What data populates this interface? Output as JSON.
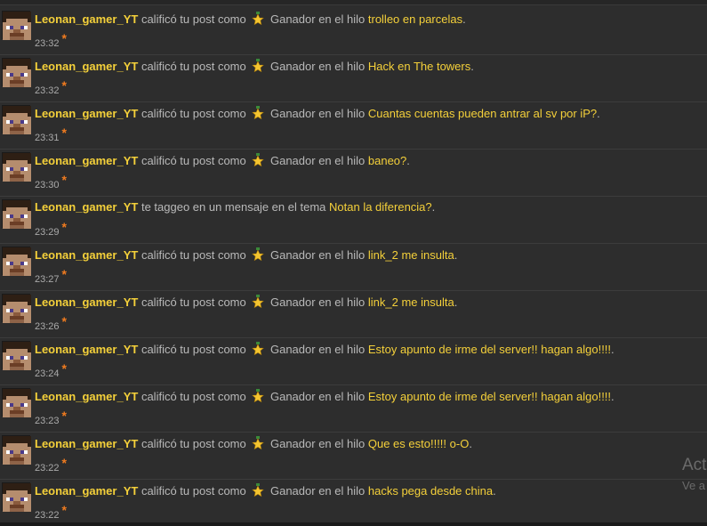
{
  "notifications": [
    {
      "user": "Leonan_gamer_YT",
      "action": "calificó tu post como",
      "rating": "Ganador",
      "context": "en el hilo",
      "thread": "trolleo en parcelas",
      "time": "23:32",
      "has_rating": true
    },
    {
      "user": "Leonan_gamer_YT",
      "action": "calificó tu post como",
      "rating": "Ganador",
      "context": "en el hilo",
      "thread": "Hack en The towers",
      "time": "23:32",
      "has_rating": true
    },
    {
      "user": "Leonan_gamer_YT",
      "action": "calificó tu post como",
      "rating": "Ganador",
      "context": "en el hilo",
      "thread": "Cuantas cuentas pueden antrar al sv por iP?",
      "time": "23:31",
      "has_rating": true
    },
    {
      "user": "Leonan_gamer_YT",
      "action": "calificó tu post como",
      "rating": "Ganador",
      "context": "en el hilo",
      "thread": "baneo?",
      "time": "23:30",
      "has_rating": true
    },
    {
      "user": "Leonan_gamer_YT",
      "action": "te taggeo en un mensaje en el tema",
      "rating": "",
      "context": "",
      "thread": "Notan la diferencia?",
      "time": "23:29",
      "has_rating": false
    },
    {
      "user": "Leonan_gamer_YT",
      "action": "calificó tu post como",
      "rating": "Ganador",
      "context": "en el hilo",
      "thread": "link_2 me insulta",
      "time": "23:27",
      "has_rating": true
    },
    {
      "user": "Leonan_gamer_YT",
      "action": "calificó tu post como",
      "rating": "Ganador",
      "context": "en el hilo",
      "thread": "link_2 me insulta",
      "time": "23:26",
      "has_rating": true
    },
    {
      "user": "Leonan_gamer_YT",
      "action": "calificó tu post como",
      "rating": "Ganador",
      "context": "en el hilo",
      "thread": "Estoy apunto de irme del server!! hagan algo!!!!",
      "time": "23:24",
      "has_rating": true
    },
    {
      "user": "Leonan_gamer_YT",
      "action": "calificó tu post como",
      "rating": "Ganador",
      "context": "en el hilo",
      "thread": "Estoy apunto de irme del server!! hagan algo!!!!",
      "time": "23:23",
      "has_rating": true
    },
    {
      "user": "Leonan_gamer_YT",
      "action": "calificó tu post como",
      "rating": "Ganador",
      "context": "en el hilo",
      "thread": "Que es esto!!!!! o-O",
      "time": "23:22",
      "has_rating": true
    },
    {
      "user": "Leonan_gamer_YT",
      "action": "calificó tu post como",
      "rating": "Ganador",
      "context": "en el hilo",
      "thread": "hacks pega desde china",
      "time": "23:22",
      "has_rating": true
    }
  ],
  "star_glyph": "*",
  "period": ".",
  "watermark": {
    "title": "Act",
    "subtitle": "Ve a"
  },
  "colors": {
    "background": "#2d2d2d",
    "username": "#f4d03a",
    "thread_link": "#f4d03a",
    "text": "#b9b9b9",
    "timestamp": "#aaaaaa",
    "star": "#f07b1f"
  },
  "icons": {
    "avatar": "minecraft-steve-avatar-icon",
    "rating": "winner-trophy-star-icon"
  }
}
